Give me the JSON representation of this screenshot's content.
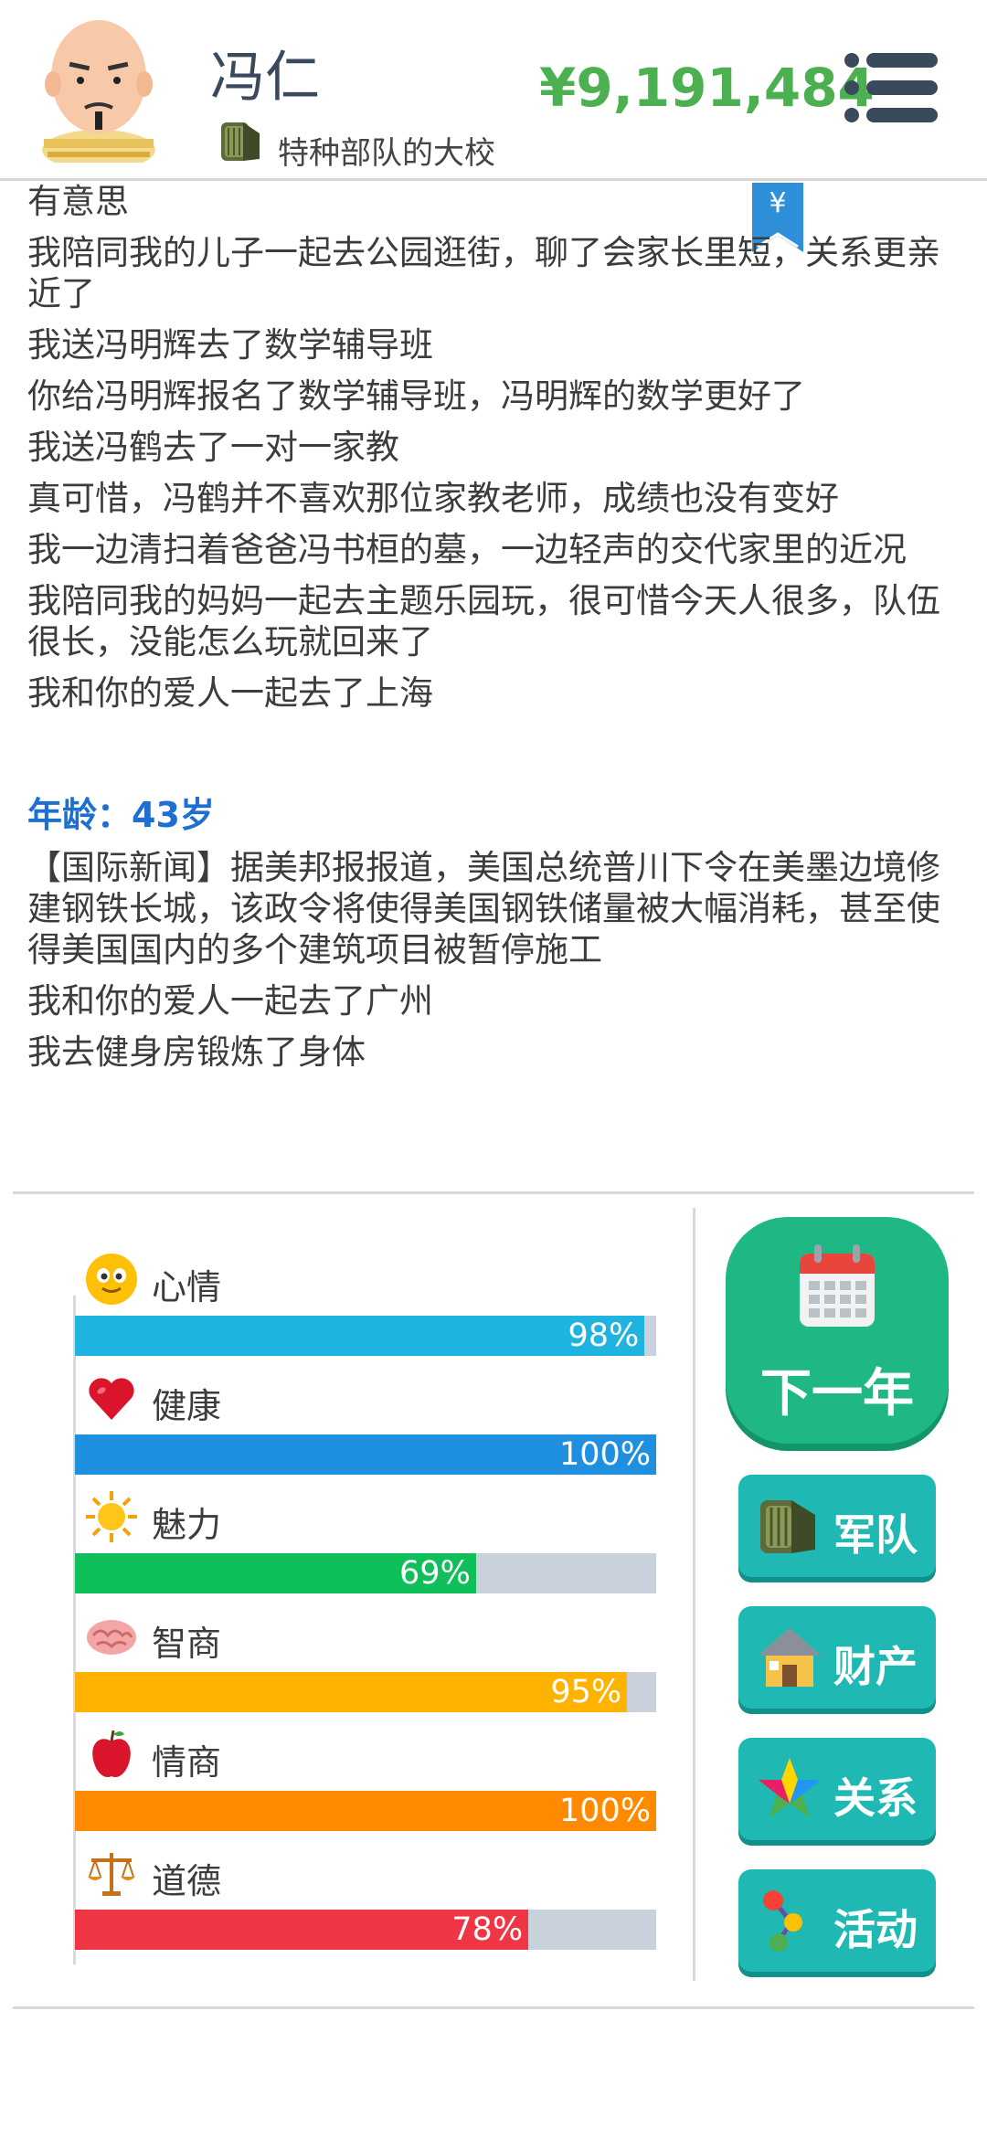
{
  "header": {
    "name": "冯仁",
    "rank": "特种部队的大校",
    "money": "¥9,191,484",
    "avatar_icon": "bald-man-avatar",
    "rank_icon": "military-badge-icon",
    "menu_icon": "menu-list-icon"
  },
  "yen_tab": {
    "label": "¥"
  },
  "log": {
    "lines_before": [
      "有意思",
      "我陪同我的儿子一起去公园逛街，聊了会家长里短，关系更亲近了",
      "我送冯明辉去了数学辅导班",
      "你给冯明辉报名了数学辅导班，冯明辉的数学更好了",
      "我送冯鹤去了一对一家教",
      "真可惜，冯鹤并不喜欢那位家教老师，成绩也没有变好",
      "我一边清扫着爸爸冯书桓的墓，一边轻声的交代家里的近况",
      "我陪同我的妈妈一起去主题乐园玩，很可惜今天人很多，队伍很长，没能怎么玩就回来了",
      "我和你的爱人一起去了上海"
    ],
    "age": "年龄：43岁",
    "lines_after": [
      "【国际新闻】据美邦报报道，美国总统普川下令在美墨边境修建钢铁长城，该政令将使得美国钢铁储量被大幅消耗，甚至使得美国国内的多个建筑项目被暂停施工",
      "我和你的爱人一起去了广州",
      "我去健身房锻炼了身体"
    ]
  },
  "stats": [
    {
      "label": "心情",
      "pct_text": "98%",
      "value": 0.98,
      "color": "#1fb3e0",
      "icon": "smiley-icon"
    },
    {
      "label": "健康",
      "pct_text": "100%",
      "value": 1.0,
      "color": "#1f8fe0",
      "icon": "heart-icon"
    },
    {
      "label": "魅力",
      "pct_text": "69%",
      "value": 0.69,
      "color": "#0fc05a",
      "icon": "sun-icon"
    },
    {
      "label": "智商",
      "pct_text": "95%",
      "value": 0.95,
      "color": "#ffb300",
      "icon": "brain-icon"
    },
    {
      "label": "情商",
      "pct_text": "100%",
      "value": 1.0,
      "color": "#ff8a00",
      "icon": "apple-icon"
    },
    {
      "label": "道德",
      "pct_text": "78%",
      "value": 0.78,
      "color": "#f03545",
      "icon": "scales-icon"
    }
  ],
  "buttons": {
    "next_year": "下一年",
    "army": "军队",
    "property": "财产",
    "relations": "关系",
    "activity": "活动"
  }
}
